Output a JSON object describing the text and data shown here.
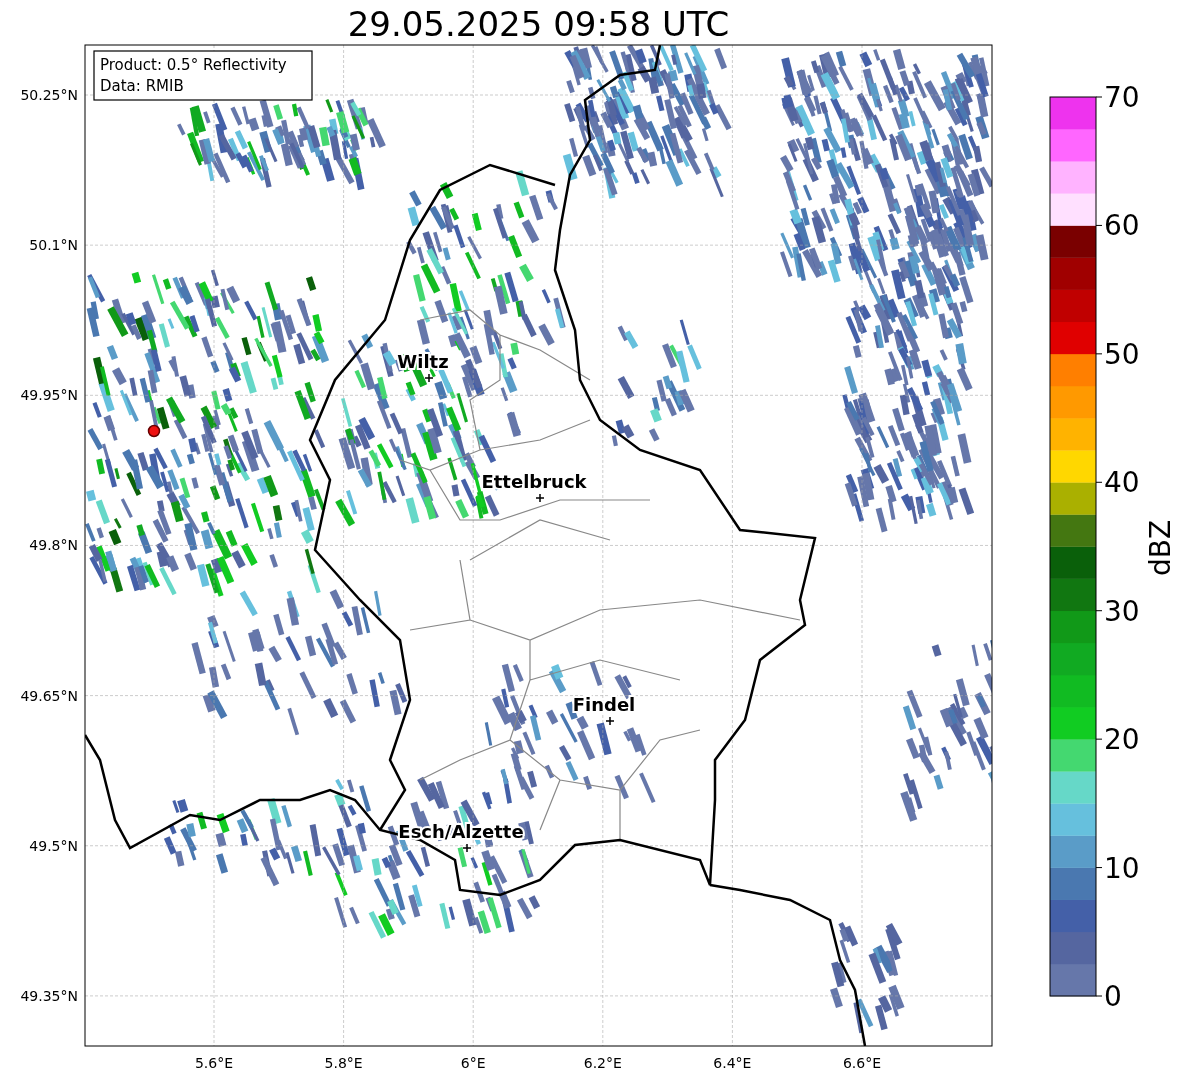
{
  "title": "29.05.2025 09:58 UTC",
  "legend": [
    "Product: 0.5° Reflectivity",
    "Data: RMIB"
  ],
  "map": {
    "x_ticks": [
      "5.6°E",
      "5.8°E",
      "6°E",
      "6.2°E",
      "6.4°E",
      "6.6°E"
    ],
    "y_ticks": [
      "50.25°N",
      "50.1°N",
      "49.95°N",
      "49.8°N",
      "49.65°N",
      "49.5°N",
      "49.35°N"
    ],
    "places": [
      {
        "name": "Wiltz"
      },
      {
        "name": "Ettelbruck"
      },
      {
        "name": "Findel"
      },
      {
        "name": "Esch/Alzette"
      }
    ]
  },
  "colorbar": {
    "label": "dBZ",
    "ticks": [
      "70",
      "60",
      "50",
      "40",
      "30",
      "20",
      "10",
      "0"
    ],
    "segments": [
      {
        "color": "#6677aa"
      },
      {
        "color": "#5566a0"
      },
      {
        "color": "#4460a8"
      },
      {
        "color": "#4a78b0"
      },
      {
        "color": "#5a9cc8"
      },
      {
        "color": "#66c0dd"
      },
      {
        "color": "#66d8c8"
      },
      {
        "color": "#44d870"
      },
      {
        "color": "#11cc22"
      },
      {
        "color": "#11bb22"
      },
      {
        "color": "#11aa22"
      },
      {
        "color": "#119918"
      },
      {
        "color": "#117711"
      },
      {
        "color": "#0a600a"
      },
      {
        "color": "#447711"
      },
      {
        "color": "#aab000"
      },
      {
        "color": "#ffd700"
      },
      {
        "color": "#ffb300"
      },
      {
        "color": "#ff9900"
      },
      {
        "color": "#ff7f00"
      },
      {
        "color": "#e00000"
      },
      {
        "color": "#c00000"
      },
      {
        "color": "#a00000"
      },
      {
        "color": "#7a0000"
      },
      {
        "color": "#ffe0ff"
      },
      {
        "color": "#ffb3ff"
      },
      {
        "color": "#ff66ff"
      },
      {
        "color": "#ee33ee"
      }
    ]
  }
}
